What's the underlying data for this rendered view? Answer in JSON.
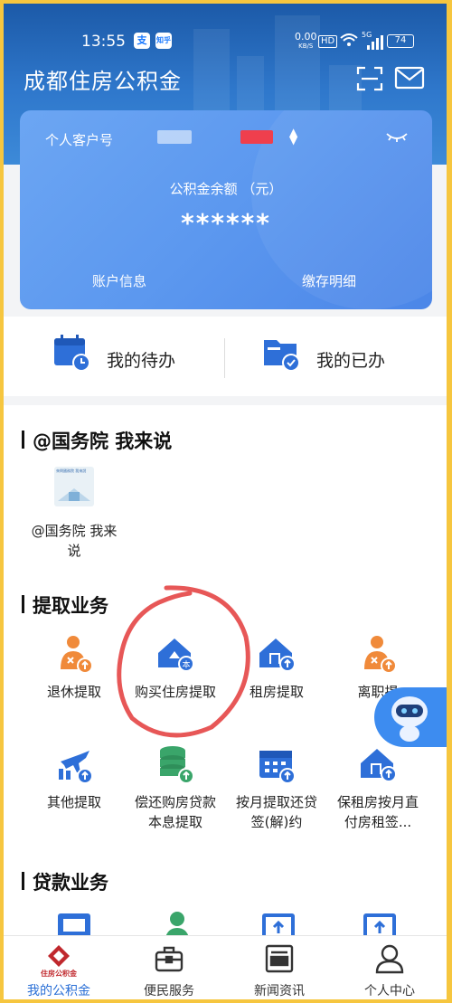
{
  "status_bar": {
    "time": "13:55",
    "app_badge_1": "支",
    "app_badge_2": "知乎",
    "net_speed": "0.00",
    "net_unit": "KB/S",
    "hd": "HD",
    "signal": "5G",
    "battery": "74"
  },
  "header": {
    "title": "成都住房公积金"
  },
  "card": {
    "account_label": "个人客户号",
    "balance_label": "公积金余额  （元）",
    "balance_value": "******",
    "account_info": "账户信息",
    "deposit_detail": "缴存明细"
  },
  "todo": {
    "pending": "我的待办",
    "done": "我的已办"
  },
  "section_gov": {
    "title": "@国务院 我来说",
    "item_label": "@国务院 我来说",
    "thumb_text": "來問國務院 我來說"
  },
  "section_withdraw": {
    "title": "提取业务",
    "items": [
      {
        "label": "退休提取",
        "icon": "retire-icon"
      },
      {
        "label": "购买住房提取",
        "icon": "house-buy-icon"
      },
      {
        "label": "租房提取",
        "icon": "house-rent-icon"
      },
      {
        "label": "离职提",
        "icon": "resign-icon"
      },
      {
        "label": "其他提取",
        "icon": "plane-icon"
      },
      {
        "label": "偿还购房贷款本息提取",
        "icon": "coins-icon"
      },
      {
        "label": "按月提取还贷签(解)约",
        "icon": "calendar-icon"
      },
      {
        "label": "保租房按月直付房租签...",
        "icon": "house-monthly-icon"
      }
    ]
  },
  "section_loan": {
    "title": "贷款业务"
  },
  "tabbar": {
    "logo_text": "住房公积金",
    "items": [
      {
        "label": "我的公积金",
        "active": true
      },
      {
        "label": "便民服务",
        "active": false
      },
      {
        "label": "新闻资讯",
        "active": false
      },
      {
        "label": "个人中心",
        "active": false
      }
    ]
  },
  "colors": {
    "accent": "#2a6fd6",
    "icon_blue": "#2e6fd8",
    "icon_orange": "#f08a3a",
    "icon_green": "#3aa56a",
    "annotation_red": "#e33a3a"
  }
}
